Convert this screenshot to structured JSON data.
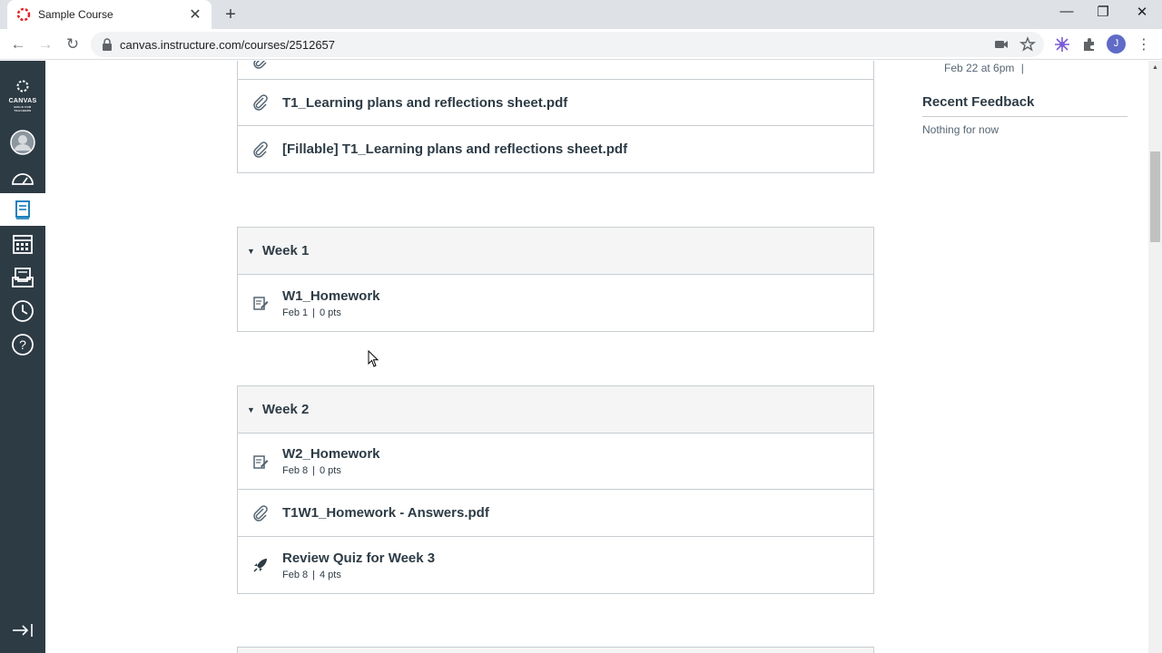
{
  "browser": {
    "tab_title": "Sample Course",
    "url": "canvas.instructure.com/courses/2512657",
    "profile_initial": "J"
  },
  "global_nav": {
    "logo_line1": "CANVAS",
    "logo_line2": "BUILD FOR TEACHERS",
    "items": [
      "account",
      "dashboard",
      "courses",
      "calendar",
      "inbox",
      "history",
      "help"
    ],
    "active": "courses"
  },
  "modules": [
    {
      "title": "",
      "items": [
        {
          "type": "attachment",
          "title": "T1_Learning plans and reflections sheet.pdf",
          "meta": ""
        },
        {
          "type": "attachment",
          "title": "[Fillable] T1_Learning plans and reflections sheet.pdf",
          "meta": ""
        }
      ]
    },
    {
      "title": "Week 1",
      "items": [
        {
          "type": "assignment",
          "title": "W1_Homework",
          "date": "Feb 1",
          "points": "0 pts"
        }
      ]
    },
    {
      "title": "Week 2",
      "items": [
        {
          "type": "assignment",
          "title": "W2_Homework",
          "date": "Feb 8",
          "points": "0 pts"
        },
        {
          "type": "attachment",
          "title": "T1W1_Homework - Answers.pdf"
        },
        {
          "type": "quiz",
          "title": "Review Quiz for Week 3",
          "date": "Feb 8",
          "points": "4 pts"
        }
      ]
    }
  ],
  "sidebar": {
    "todo_date": "Feb 22 at 6pm",
    "todo_sep": "|",
    "recent_feedback_title": "Recent Feedback",
    "recent_feedback_empty": "Nothing for now"
  },
  "colors": {
    "nav_bg": "#2d3b45",
    "active_icon": "#0374b5",
    "border": "#c7cdd1",
    "header_bg": "#f5f5f5"
  }
}
